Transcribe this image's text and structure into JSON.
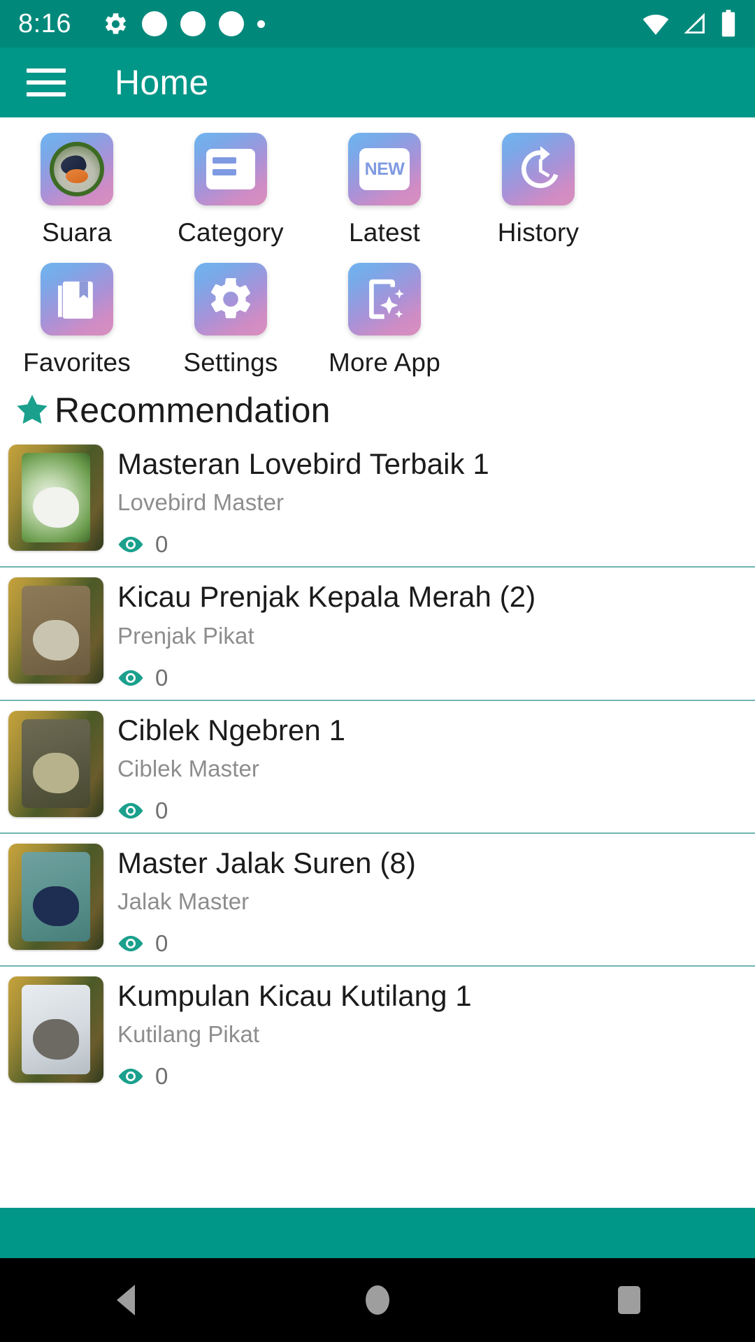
{
  "status_bar": {
    "time": "8:16",
    "left_icons": [
      "gear-icon",
      "notification-dot-icon",
      "notification-dot-icon",
      "notification-dot-icon",
      "small-dot-icon"
    ],
    "right_icons": [
      "wifi-icon",
      "cellular-signal-icon",
      "battery-icon"
    ]
  },
  "app_bar": {
    "menu_icon": "hamburger-menu-icon",
    "title": "Home"
  },
  "theme": {
    "primary": "#009688",
    "status_bar": "#00897B",
    "accent_star": "#1aa08d",
    "eye_icon": "#1aa08d",
    "divider": "#6fb7b0",
    "title_text": "#1b1b1b",
    "subtitle_text": "#8d8d8d",
    "tile_gradient_from": "#cf8cc4",
    "tile_gradient_to": "#27a3f5"
  },
  "grid": {
    "rows": [
      [
        {
          "label": "Suara",
          "icon": "bird-photo-icon"
        },
        {
          "label": "Category",
          "icon": "category-card-icon"
        },
        {
          "label": "Latest",
          "icon": "new-badge-icon",
          "badge_text": "NEW"
        },
        {
          "label": "History",
          "icon": "history-clock-icon"
        }
      ],
      [
        {
          "label": "Favorites",
          "icon": "bookmark-library-icon"
        },
        {
          "label": "Settings",
          "icon": "gear-icon"
        },
        {
          "label": "More App",
          "icon": "phone-sparkle-icon"
        }
      ]
    ]
  },
  "recommendation": {
    "icon": "star-icon",
    "title": "Recommendation",
    "items": [
      {
        "title": "Masteran Lovebird Terbaik 1",
        "subtitle": "Lovebird Master",
        "views": "0",
        "thumb": "lovebird-pair-thumbnail"
      },
      {
        "title": "Kicau Prenjak Kepala Merah (2)",
        "subtitle": "Prenjak Pikat",
        "views": "0",
        "thumb": "prenjak-bird-thumbnail"
      },
      {
        "title": "Ciblek Ngebren 1",
        "subtitle": "Ciblek Master",
        "views": "0",
        "thumb": "ciblek-bird-thumbnail"
      },
      {
        "title": "Master Jalak Suren (8)",
        "subtitle": "Jalak Master",
        "views": "0",
        "thumb": "jalak-suren-thumbnail"
      },
      {
        "title": "Kumpulan Kicau Kutilang 1",
        "subtitle": "Kutilang Pikat",
        "views": "0",
        "thumb": "kutilang-pair-thumbnail"
      }
    ]
  },
  "navigation_bar": {
    "back": "back-triangle-icon",
    "home": "home-circle-icon",
    "recents": "recents-square-icon"
  }
}
